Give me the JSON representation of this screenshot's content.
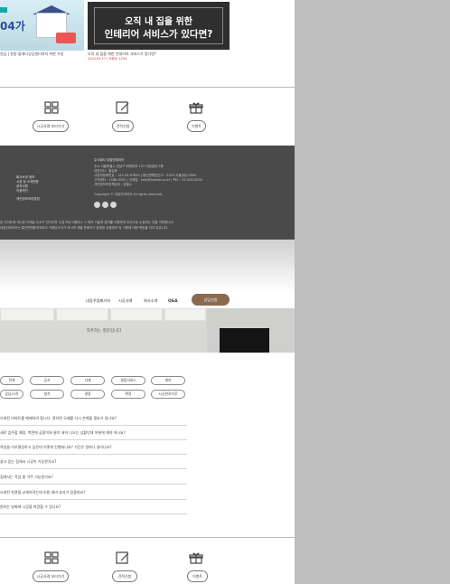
{
  "top_cards": [
    {
      "thumb_label": "04가",
      "caption": "연금 | 현장-플래너상담센터까지 착한 가성"
    },
    {
      "thumb_title_line1": "오직 내 집을 위한",
      "thumb_title_line2": "인테리어 서비스가 있다면?",
      "caption": "오직 내 집을 위한 인테리어 서비스가 있다면?",
      "caption_sub": "2023.05.17 | 조회수 1234"
    }
  ],
  "quick_links_top": [
    {
      "icon": "grid-icon",
      "label": "시공사례 보러가기"
    },
    {
      "icon": "edit-icon",
      "label": "견적신청"
    },
    {
      "icon": "gift-icon",
      "label": "이벤트"
    }
  ],
  "footer": {
    "menu": [
      "회사소개 정보",
      "시공 및 소재전문",
      "공지사항",
      "이용약관",
      "개인정보처리방침"
    ],
    "company_title": "주식회사 내집인테리어",
    "info_lines": [
      "주소 서울특별시 강남구 테헤란로 123 내집빌딩 5층",
      "대표이사 : 홍길동",
      "사업자등록번호 : 123-45-67890 | 통신판매업신고 : 2023-서울강남-0000",
      "고객센터 : 1588-0000 | 이메일 : help@naezip.co.kr | 팩스 : 02-000-0000",
      "개인정보보호책임자 : 김철수"
    ],
    "copyright": "Copyright © 내집인테리어 All rights reserved.",
    "sns": [
      "blog-icon",
      "instagram-icon",
      "youtube-icon"
    ],
    "bottom_line1": "본 사이트에 게시된 이메일 주소가 전자우편 수집 프로그램이나 그 밖의 기술적 장치를 이용하여 무단으로 수집되는 것을 거부합니다.",
    "bottom_line2": "내집인테리어는 통신판매중개자로서 거래당사자가 아니며 개별 판매자가 등록한 상품정보 및 거래에 대한 책임을 지지 않습니다."
  },
  "nav": {
    "items": [
      "내집꾸밈패키지",
      "시공사례",
      "회사소개",
      "Q&A"
    ],
    "cta": "상담신청"
  },
  "hero": {
    "title": "자주하는 질문입니다"
  },
  "filter_tags": [
    "전체",
    "공사",
    "자재",
    "결합서비스",
    "계약",
    "상담/시작",
    "설치",
    "결정",
    "확정",
    "시공완료이후"
  ],
  "faq": [
    "오래된 아파트를 매매하려 합니다. 잘하면 도배를 다시 손해볼 필요가 있나요?",
    "새로 입주할 예정, 벽면에 곰팡이와 물이 새어 나오는 상황인데 어떻게 해야 하나요?",
    "욕실을 리모델링하고 싶은데 어떻게 진행되나요? 기간은 얼마나 걸리나요?",
    "살고 있는 집에서 시공이 가능한가요?",
    "집에서는 작업 중 거주 가능한가요?",
    "오래된 현관을 교체하려는데 비용 대비 효과가 있을까요?",
    "원하는 날짜에 시공을 희망할 수 있나요?"
  ],
  "quick_links_bottom": [
    {
      "icon": "grid-icon",
      "label": "시공사례 보러가기"
    },
    {
      "icon": "edit-icon",
      "label": "견적신청"
    },
    {
      "icon": "gift-icon",
      "label": "이벤트"
    }
  ],
  "colors": {
    "footer_bg": "#4a4a4a",
    "cta_bg": "#8a6a4f",
    "outside_bg": "#bdbdbd"
  }
}
